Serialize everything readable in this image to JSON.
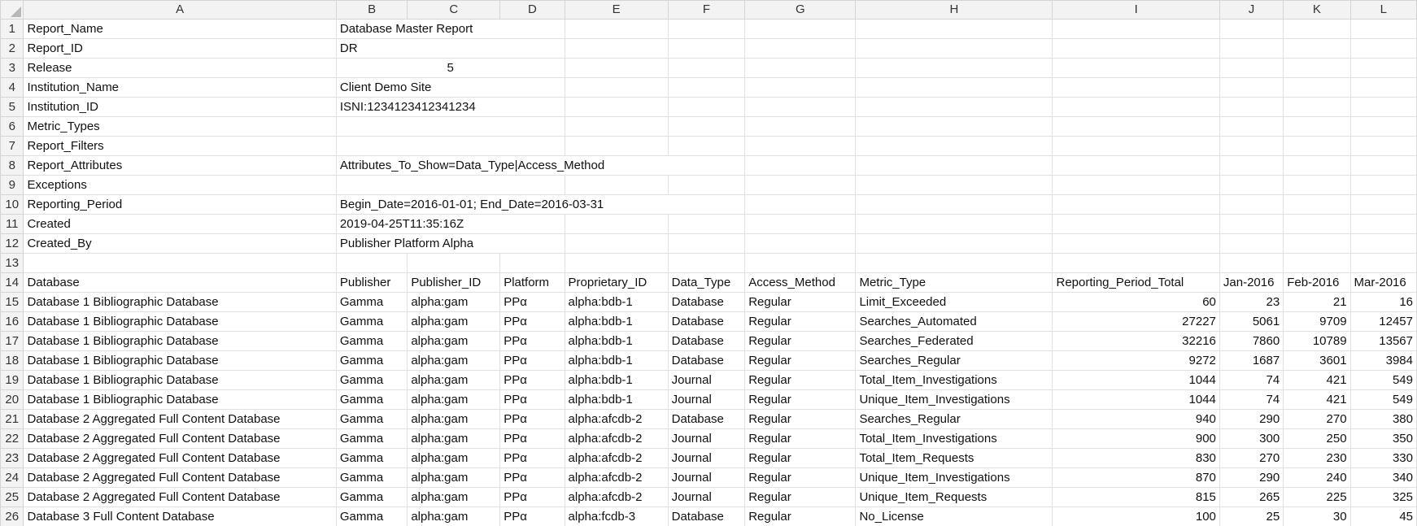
{
  "columns": [
    "A",
    "B",
    "C",
    "D",
    "E",
    "F",
    "G",
    "H",
    "I",
    "J",
    "K",
    "L"
  ],
  "rows": [
    {
      "n": "1",
      "cells": [
        {
          "t": "Report_Name"
        },
        {
          "t": "Database Master Report",
          "span": 3
        }
      ]
    },
    {
      "n": "2",
      "cells": [
        {
          "t": "Report_ID"
        },
        {
          "t": "DR",
          "span": 3
        }
      ]
    },
    {
      "n": "3",
      "cells": [
        {
          "t": "Release"
        },
        {
          "t": "5",
          "span": 3,
          "align": "center"
        }
      ]
    },
    {
      "n": "4",
      "cells": [
        {
          "t": "Institution_Name"
        },
        {
          "t": "Client Demo Site",
          "span": 3
        }
      ]
    },
    {
      "n": "5",
      "cells": [
        {
          "t": "Institution_ID"
        },
        {
          "t": "ISNI:1234123412341234",
          "span": 3
        }
      ]
    },
    {
      "n": "6",
      "cells": [
        {
          "t": "Metric_Types"
        },
        {
          "t": "",
          "span": 3
        }
      ]
    },
    {
      "n": "7",
      "cells": [
        {
          "t": "Report_Filters"
        },
        {
          "t": "",
          "span": 3
        }
      ]
    },
    {
      "n": "8",
      "cells": [
        {
          "t": "Report_Attributes"
        },
        {
          "t": "Attributes_To_Show=Data_Type|Access_Method",
          "span": 5
        }
      ]
    },
    {
      "n": "9",
      "cells": [
        {
          "t": "Exceptions"
        },
        {
          "t": "",
          "span": 3
        }
      ]
    },
    {
      "n": "10",
      "cells": [
        {
          "t": "Reporting_Period"
        },
        {
          "t": "Begin_Date=2016-01-01; End_Date=2016-03-31",
          "span": 5
        }
      ]
    },
    {
      "n": "11",
      "cells": [
        {
          "t": "Created"
        },
        {
          "t": "2019-04-25T11:35:16Z",
          "span": 3
        }
      ]
    },
    {
      "n": "12",
      "cells": [
        {
          "t": "Created_By"
        },
        {
          "t": "Publisher Platform Alpha",
          "span": 3
        }
      ]
    },
    {
      "n": "13",
      "cells": []
    },
    {
      "n": "14",
      "cells": [
        {
          "t": "Database"
        },
        {
          "t": "Publisher"
        },
        {
          "t": "Publisher_ID"
        },
        {
          "t": "Platform"
        },
        {
          "t": "Proprietary_ID"
        },
        {
          "t": "Data_Type"
        },
        {
          "t": "Access_Method"
        },
        {
          "t": "Metric_Type"
        },
        {
          "t": "Reporting_Period_Total"
        },
        {
          "t": "Jan-2016"
        },
        {
          "t": "Feb-2016"
        },
        {
          "t": "Mar-2016"
        }
      ]
    },
    {
      "n": "15",
      "cells": [
        {
          "t": "Database 1 Bibliographic Database"
        },
        {
          "t": "Gamma"
        },
        {
          "t": "alpha:gam"
        },
        {
          "t": "PPα"
        },
        {
          "t": "alpha:bdb-1"
        },
        {
          "t": "Database"
        },
        {
          "t": "Regular"
        },
        {
          "t": "Limit_Exceeded"
        },
        {
          "t": "60",
          "num": true
        },
        {
          "t": "23",
          "num": true
        },
        {
          "t": "21",
          "num": true
        },
        {
          "t": "16",
          "num": true
        }
      ]
    },
    {
      "n": "16",
      "cells": [
        {
          "t": "Database 1 Bibliographic Database"
        },
        {
          "t": "Gamma"
        },
        {
          "t": "alpha:gam"
        },
        {
          "t": "PPα"
        },
        {
          "t": "alpha:bdb-1"
        },
        {
          "t": "Database"
        },
        {
          "t": "Regular"
        },
        {
          "t": "Searches_Automated"
        },
        {
          "t": "27227",
          "num": true
        },
        {
          "t": "5061",
          "num": true
        },
        {
          "t": "9709",
          "num": true
        },
        {
          "t": "12457",
          "num": true
        }
      ]
    },
    {
      "n": "17",
      "cells": [
        {
          "t": "Database 1 Bibliographic Database"
        },
        {
          "t": "Gamma"
        },
        {
          "t": "alpha:gam"
        },
        {
          "t": "PPα"
        },
        {
          "t": "alpha:bdb-1"
        },
        {
          "t": "Database"
        },
        {
          "t": "Regular"
        },
        {
          "t": "Searches_Federated"
        },
        {
          "t": "32216",
          "num": true
        },
        {
          "t": "7860",
          "num": true
        },
        {
          "t": "10789",
          "num": true
        },
        {
          "t": "13567",
          "num": true
        }
      ]
    },
    {
      "n": "18",
      "cells": [
        {
          "t": "Database 1 Bibliographic Database"
        },
        {
          "t": "Gamma"
        },
        {
          "t": "alpha:gam"
        },
        {
          "t": "PPα"
        },
        {
          "t": "alpha:bdb-1"
        },
        {
          "t": "Database"
        },
        {
          "t": "Regular"
        },
        {
          "t": "Searches_Regular"
        },
        {
          "t": "9272",
          "num": true
        },
        {
          "t": "1687",
          "num": true
        },
        {
          "t": "3601",
          "num": true
        },
        {
          "t": "3984",
          "num": true
        }
      ]
    },
    {
      "n": "19",
      "cells": [
        {
          "t": "Database 1 Bibliographic Database"
        },
        {
          "t": "Gamma"
        },
        {
          "t": "alpha:gam"
        },
        {
          "t": "PPα"
        },
        {
          "t": "alpha:bdb-1"
        },
        {
          "t": "Journal"
        },
        {
          "t": "Regular"
        },
        {
          "t": "Total_Item_Investigations"
        },
        {
          "t": "1044",
          "num": true
        },
        {
          "t": "74",
          "num": true
        },
        {
          "t": "421",
          "num": true
        },
        {
          "t": "549",
          "num": true
        }
      ]
    },
    {
      "n": "20",
      "cells": [
        {
          "t": "Database 1 Bibliographic Database"
        },
        {
          "t": "Gamma"
        },
        {
          "t": "alpha:gam"
        },
        {
          "t": "PPα"
        },
        {
          "t": "alpha:bdb-1"
        },
        {
          "t": "Journal"
        },
        {
          "t": "Regular"
        },
        {
          "t": "Unique_Item_Investigations"
        },
        {
          "t": "1044",
          "num": true
        },
        {
          "t": "74",
          "num": true
        },
        {
          "t": "421",
          "num": true
        },
        {
          "t": "549",
          "num": true
        }
      ]
    },
    {
      "n": "21",
      "cells": [
        {
          "t": "Database 2 Aggregated Full Content Database"
        },
        {
          "t": "Gamma"
        },
        {
          "t": "alpha:gam"
        },
        {
          "t": "PPα"
        },
        {
          "t": "alpha:afcdb-2"
        },
        {
          "t": "Database"
        },
        {
          "t": "Regular"
        },
        {
          "t": "Searches_Regular"
        },
        {
          "t": "940",
          "num": true
        },
        {
          "t": "290",
          "num": true
        },
        {
          "t": "270",
          "num": true
        },
        {
          "t": "380",
          "num": true
        }
      ]
    },
    {
      "n": "22",
      "cells": [
        {
          "t": "Database 2 Aggregated Full Content Database"
        },
        {
          "t": "Gamma"
        },
        {
          "t": "alpha:gam"
        },
        {
          "t": "PPα"
        },
        {
          "t": "alpha:afcdb-2"
        },
        {
          "t": "Journal"
        },
        {
          "t": "Regular"
        },
        {
          "t": "Total_Item_Investigations"
        },
        {
          "t": "900",
          "num": true
        },
        {
          "t": "300",
          "num": true
        },
        {
          "t": "250",
          "num": true
        },
        {
          "t": "350",
          "num": true
        }
      ]
    },
    {
      "n": "23",
      "cells": [
        {
          "t": "Database 2 Aggregated Full Content Database"
        },
        {
          "t": "Gamma"
        },
        {
          "t": "alpha:gam"
        },
        {
          "t": "PPα"
        },
        {
          "t": "alpha:afcdb-2"
        },
        {
          "t": "Journal"
        },
        {
          "t": "Regular"
        },
        {
          "t": "Total_Item_Requests"
        },
        {
          "t": "830",
          "num": true
        },
        {
          "t": "270",
          "num": true
        },
        {
          "t": "230",
          "num": true
        },
        {
          "t": "330",
          "num": true
        }
      ]
    },
    {
      "n": "24",
      "cells": [
        {
          "t": "Database 2 Aggregated Full Content Database"
        },
        {
          "t": "Gamma"
        },
        {
          "t": "alpha:gam"
        },
        {
          "t": "PPα"
        },
        {
          "t": "alpha:afcdb-2"
        },
        {
          "t": "Journal"
        },
        {
          "t": "Regular"
        },
        {
          "t": "Unique_Item_Investigations"
        },
        {
          "t": "870",
          "num": true
        },
        {
          "t": "290",
          "num": true
        },
        {
          "t": "240",
          "num": true
        },
        {
          "t": "340",
          "num": true
        }
      ]
    },
    {
      "n": "25",
      "cells": [
        {
          "t": "Database 2 Aggregated Full Content Database"
        },
        {
          "t": "Gamma"
        },
        {
          "t": "alpha:gam"
        },
        {
          "t": "PPα"
        },
        {
          "t": "alpha:afcdb-2"
        },
        {
          "t": "Journal"
        },
        {
          "t": "Regular"
        },
        {
          "t": "Unique_Item_Requests"
        },
        {
          "t": "815",
          "num": true
        },
        {
          "t": "265",
          "num": true
        },
        {
          "t": "225",
          "num": true
        },
        {
          "t": "325",
          "num": true
        }
      ]
    },
    {
      "n": "26",
      "cells": [
        {
          "t": "Database 3 Full Content Database"
        },
        {
          "t": "Gamma"
        },
        {
          "t": "alpha:gam"
        },
        {
          "t": "PPα"
        },
        {
          "t": "alpha:fcdb-3"
        },
        {
          "t": "Database"
        },
        {
          "t": "Regular"
        },
        {
          "t": "No_License"
        },
        {
          "t": "100",
          "num": true
        },
        {
          "t": "25",
          "num": true
        },
        {
          "t": "30",
          "num": true
        },
        {
          "t": "45",
          "num": true
        }
      ]
    }
  ]
}
